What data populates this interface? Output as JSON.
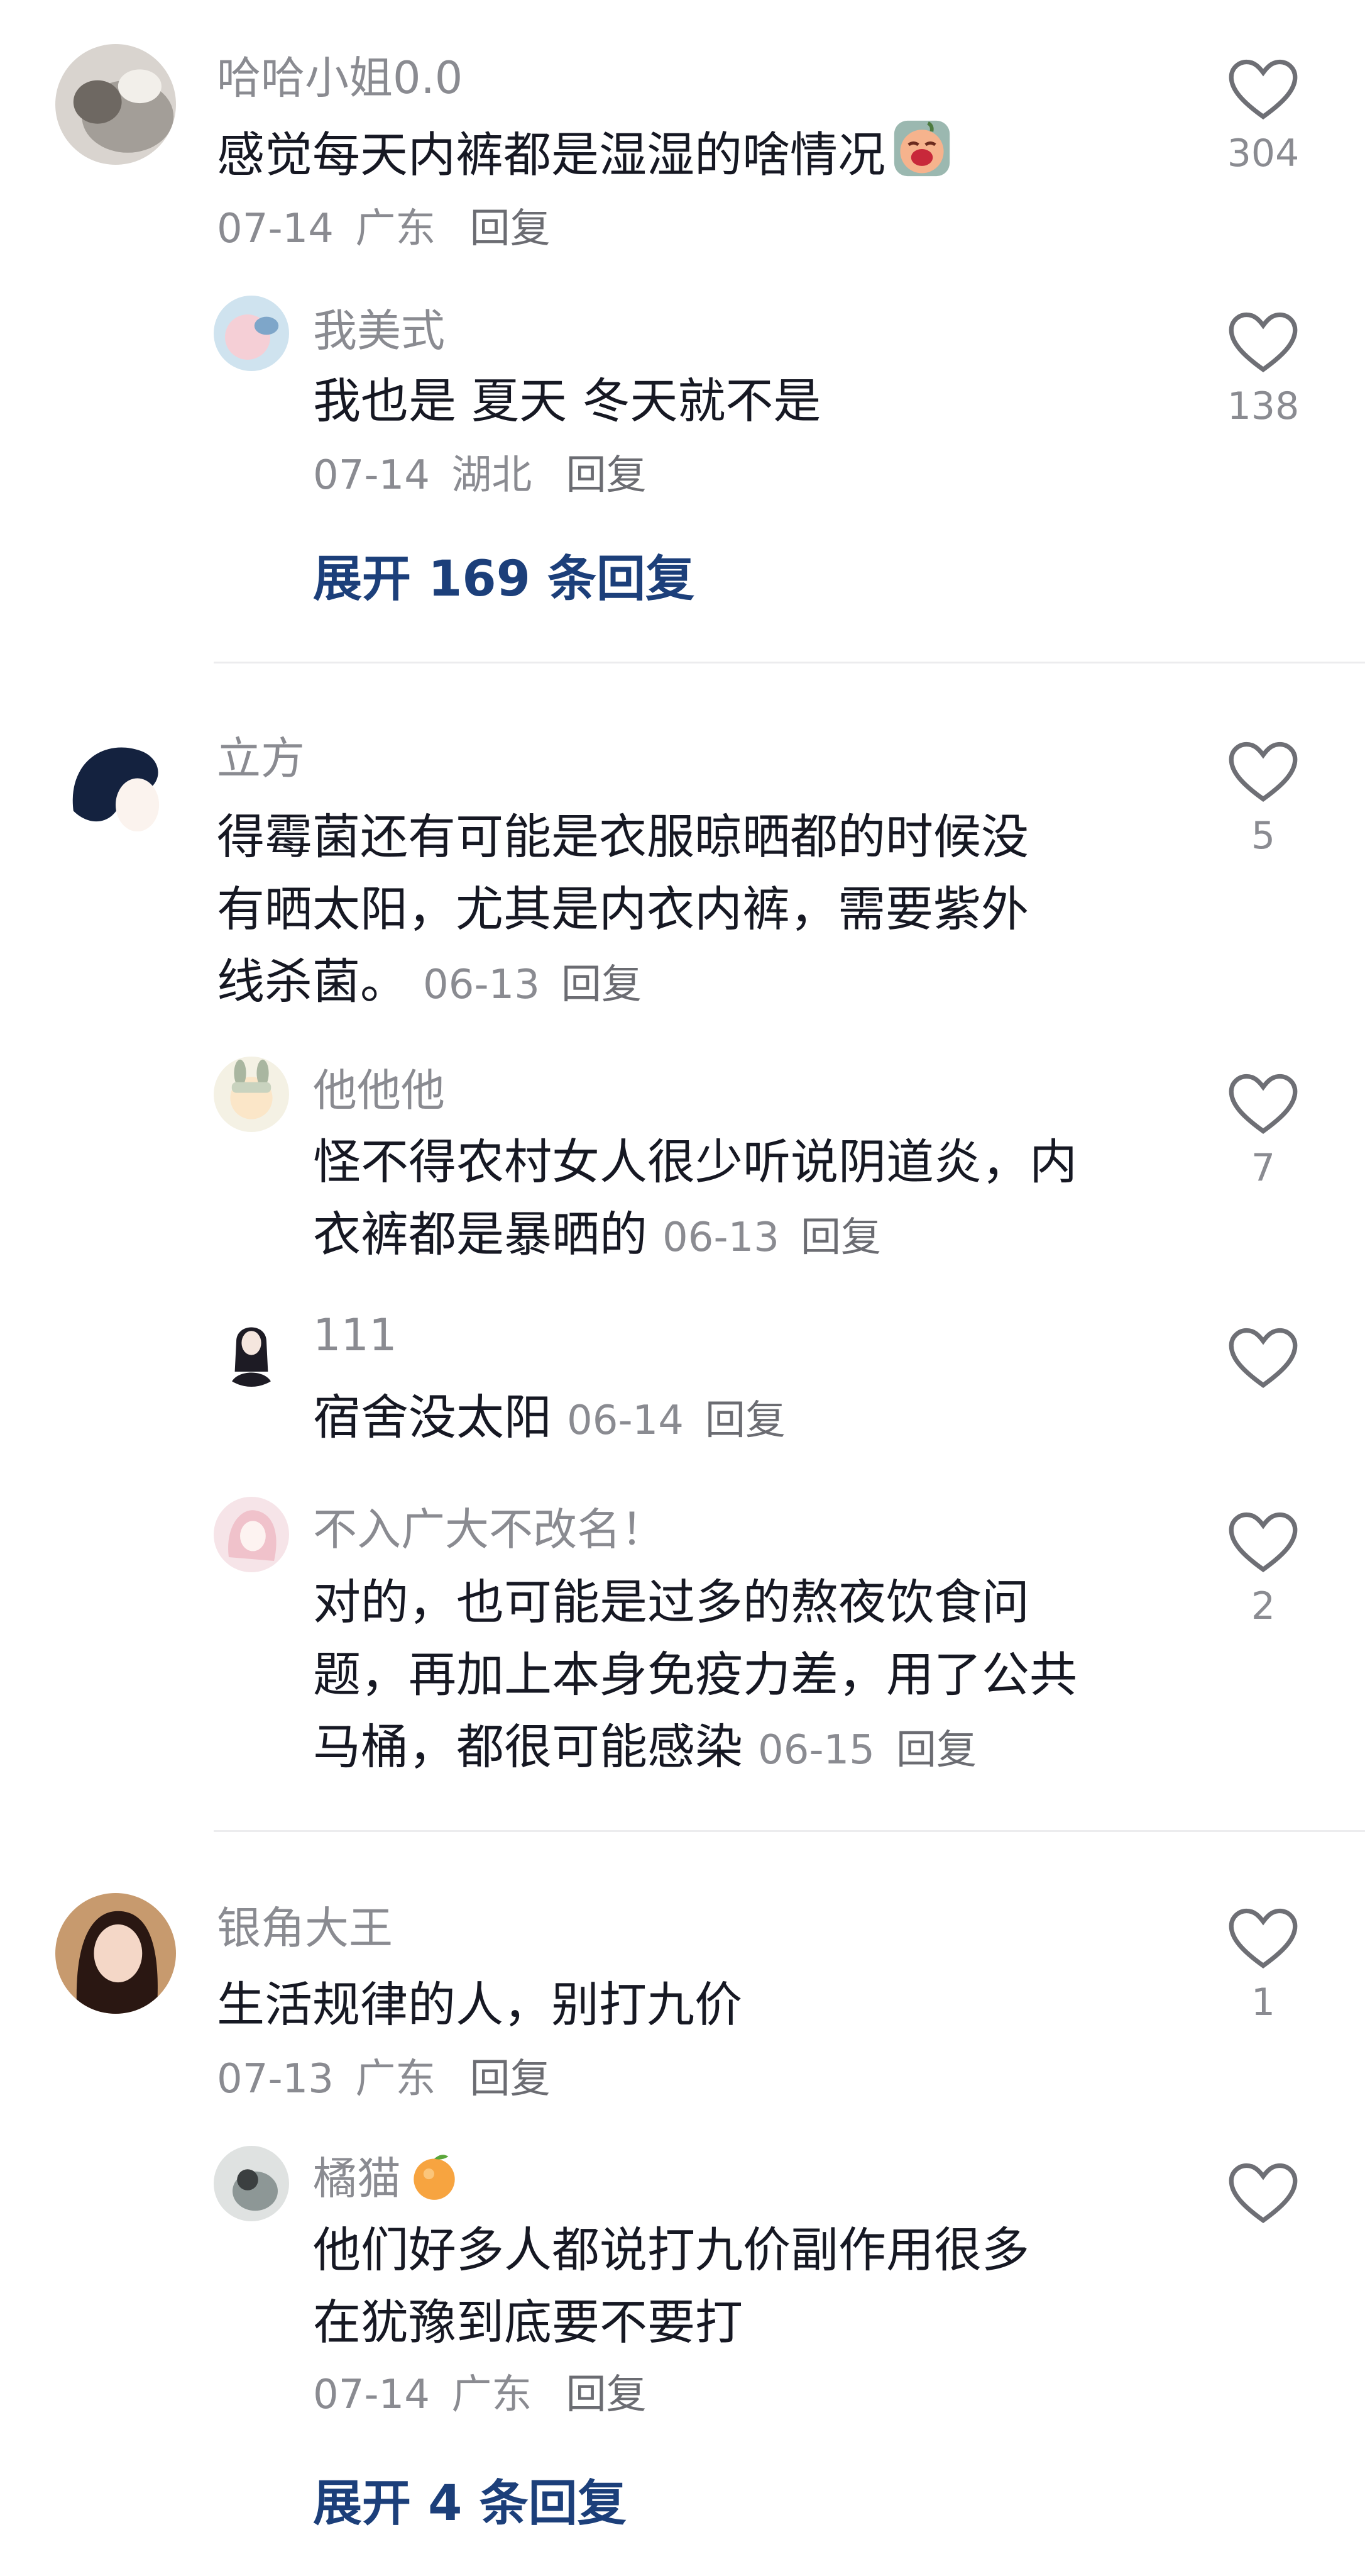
{
  "comments": [
    {
      "username": "哈哈小姐0.0",
      "text": "感觉每天内裤都是湿湿的啥情况",
      "date": "07-14",
      "location": "广东",
      "reply_label": "回复",
      "likes": "304",
      "replies": [
        {
          "username": "我美式",
          "text": "我也是 夏天 冬天就不是",
          "date": "07-14",
          "location": "湖北",
          "reply_label": "回复",
          "likes": "138"
        }
      ],
      "expand_label": "展开 169 条回复"
    },
    {
      "username": "立方",
      "text": "得霉菌还有可能是衣服晾晒都的时候没有晒太阳，尤其是内衣内裤，需要紫外线杀菌。",
      "text_lines": [
        "得霉菌还有可能是衣服晾晒都的时候没",
        "有晒太阳，尤其是内衣内裤，需要紫外",
        "线杀菌。"
      ],
      "date": "06-13",
      "reply_label": "回复",
      "likes": "5",
      "replies": [
        {
          "username": "他他他",
          "text_lines": [
            "怪不得农村女人很少听说阴道炎，内",
            "衣裤都是暴晒的"
          ],
          "date": "06-13",
          "reply_label": "回复",
          "likes": "7"
        },
        {
          "username": "111",
          "text_lines": [
            "宿舍没太阳"
          ],
          "date": "06-14",
          "reply_label": "回复",
          "likes": ""
        },
        {
          "username": "不入广大不改名！",
          "text_lines": [
            "对的，也可能是过多的熬夜饮食问",
            "题，再加上本身免疫力差，用了公共",
            "马桶，都很可能感染"
          ],
          "date": "06-15",
          "reply_label": "回复",
          "likes": "2"
        }
      ]
    },
    {
      "username": "银角大王",
      "text": "生活规律的人，别打九价",
      "date": "07-13",
      "location": "广东",
      "reply_label": "回复",
      "likes": "1",
      "replies": [
        {
          "username": "橘猫",
          "username_emoji": "tangerine-emoji",
          "text_lines": [
            "他们好多人都说打九价副作用很多",
            "在犹豫到底要不要打"
          ],
          "date": "07-14",
          "location": "广东",
          "reply_label": "回复",
          "likes": ""
        }
      ],
      "expand_label": "展开 4 条回复"
    }
  ],
  "icons": {
    "like": "heart-outline-icon",
    "emoji": "crying-face-emoji"
  },
  "colors": {
    "username": "#8a8b91",
    "text": "#161823",
    "expand": "#1c3f7a",
    "divider": "#ececee"
  }
}
